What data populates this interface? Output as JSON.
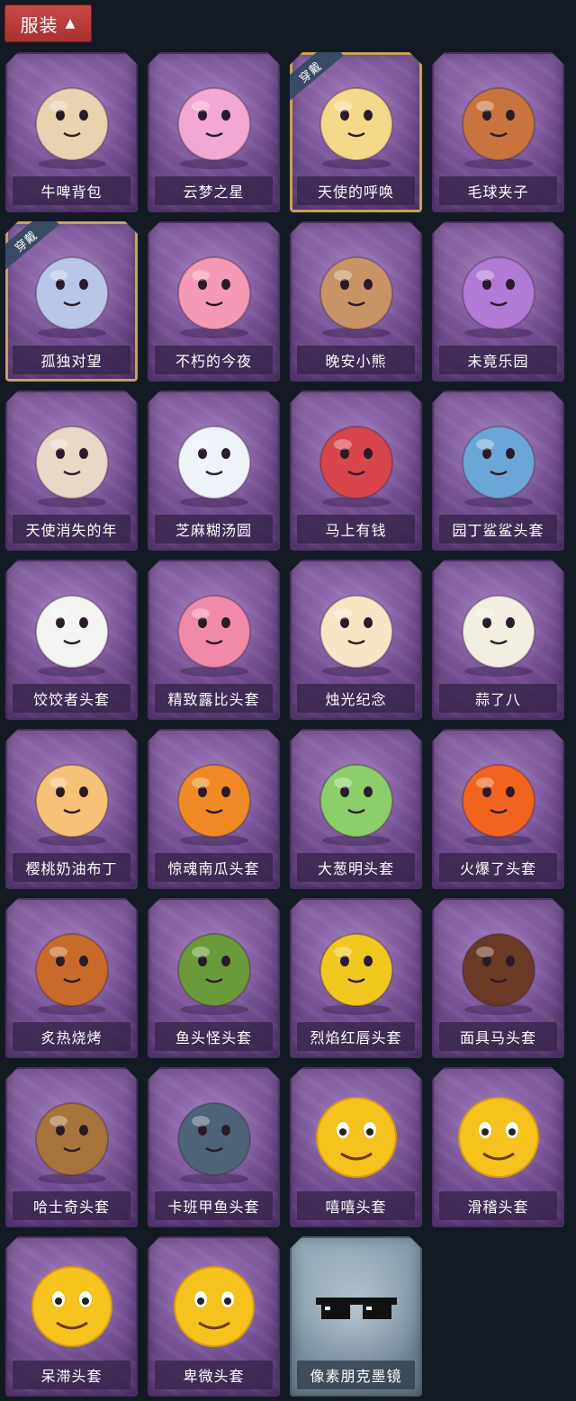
{
  "header": {
    "label": "服装",
    "chevron_icon": "chevron-up-icon"
  },
  "equipped_badge": "穿戴",
  "items": [
    {
      "name": "牛啤背包",
      "icon": "cow-beer-mug-icon",
      "color": "#e8d2b0",
      "equipped": false,
      "special": false
    },
    {
      "name": "云梦之星",
      "icon": "unicorn-cloud-icon",
      "color": "#f2a8d2",
      "equipped": false,
      "special": false
    },
    {
      "name": "天使的呼唤",
      "icon": "angel-halo-icon",
      "color": "#f5d98a",
      "equipped": true,
      "special": false
    },
    {
      "name": "毛球夹子",
      "icon": "raccoon-drummer-icon",
      "color": "#c9733e",
      "equipped": false,
      "special": false
    },
    {
      "name": "孤独对望",
      "icon": "silver-hair-doll-icon",
      "color": "#b9c6e8",
      "equipped": true,
      "special": false
    },
    {
      "name": "不朽的今夜",
      "icon": "pink-fox-icon",
      "color": "#f59ab6",
      "equipped": false,
      "special": false
    },
    {
      "name": "晚安小熊",
      "icon": "teddy-bear-icon",
      "color": "#c89466",
      "equipped": false,
      "special": false
    },
    {
      "name": "未竟乐园",
      "icon": "purple-hair-doll-icon",
      "color": "#b07ad6",
      "equipped": false,
      "special": false
    },
    {
      "name": "天使消失的年",
      "icon": "veiled-angel-icon",
      "color": "#e8d8c8",
      "equipped": false,
      "special": false
    },
    {
      "name": "芝麻糊汤圆",
      "icon": "rice-ball-icon",
      "color": "#eef4fa",
      "equipped": false,
      "special": false
    },
    {
      "name": "马上有钱",
      "icon": "red-horse-icon",
      "color": "#d8454a",
      "equipped": false,
      "special": false
    },
    {
      "name": "园丁鲨鲨头套",
      "icon": "shark-bee-icon",
      "color": "#6aa6d8",
      "equipped": false,
      "special": false
    },
    {
      "name": "饺饺者头套",
      "icon": "dumpling-icon",
      "color": "#f4f4f2",
      "equipped": false,
      "special": false
    },
    {
      "name": "精致露比头套",
      "icon": "pink-beaver-icon",
      "color": "#ef8aa8",
      "equipped": false,
      "special": false
    },
    {
      "name": "烛光纪念",
      "icon": "candle-icon",
      "color": "#f6e6c6",
      "equipped": false,
      "special": false
    },
    {
      "name": "蒜了八",
      "icon": "garlic-icon",
      "color": "#f2efe2",
      "equipped": false,
      "special": false
    },
    {
      "name": "樱桃奶油布丁",
      "icon": "pudding-icon",
      "color": "#f6c278",
      "equipped": false,
      "special": false
    },
    {
      "name": "惊魂南瓜头套",
      "icon": "pumpkin-icon",
      "color": "#f08a24",
      "equipped": false,
      "special": false
    },
    {
      "name": "大葱明头套",
      "icon": "green-onion-icon",
      "color": "#8ccf6a",
      "equipped": false,
      "special": false
    },
    {
      "name": "火爆了头套",
      "icon": "fire-icon",
      "color": "#f2641e",
      "equipped": false,
      "special": false
    },
    {
      "name": "炙热烧烤",
      "icon": "grill-meat-icon",
      "color": "#c86a2a",
      "equipped": false,
      "special": false
    },
    {
      "name": "鱼头怪头套",
      "icon": "fish-head-icon",
      "color": "#6b9a3a",
      "equipped": false,
      "special": false
    },
    {
      "name": "烈焰红唇头套",
      "icon": "yellow-mascot-icon",
      "color": "#f0c820",
      "equipped": false,
      "special": false
    },
    {
      "name": "面具马头套",
      "icon": "horse-mask-icon",
      "color": "#6a3a26",
      "equipped": false,
      "special": false
    },
    {
      "name": "哈士奇头套",
      "icon": "husky-icon",
      "color": "#a8743e",
      "equipped": false,
      "special": false
    },
    {
      "name": "卡班甲鱼头套",
      "icon": "blue-fish-icon",
      "color": "#4e6278",
      "equipped": false,
      "special": false
    },
    {
      "name": "嘻嘻头套",
      "icon": "grin-emoji-icon",
      "color": "#f5c21e",
      "equipped": false,
      "special": false
    },
    {
      "name": "滑稽头套",
      "icon": "funny-emoji-icon",
      "color": "#f5c21e",
      "equipped": false,
      "special": false
    },
    {
      "name": "呆滞头套",
      "icon": "stunned-emoji-icon",
      "color": "#f5c21e",
      "equipped": false,
      "special": false
    },
    {
      "name": "卑微头套",
      "icon": "humble-emoji-icon",
      "color": "#f5c21e",
      "equipped": false,
      "special": false
    },
    {
      "name": "像素朋克墨镜",
      "icon": "pixel-sunglasses-icon",
      "color": "#111111",
      "equipped": false,
      "special": true
    }
  ]
}
